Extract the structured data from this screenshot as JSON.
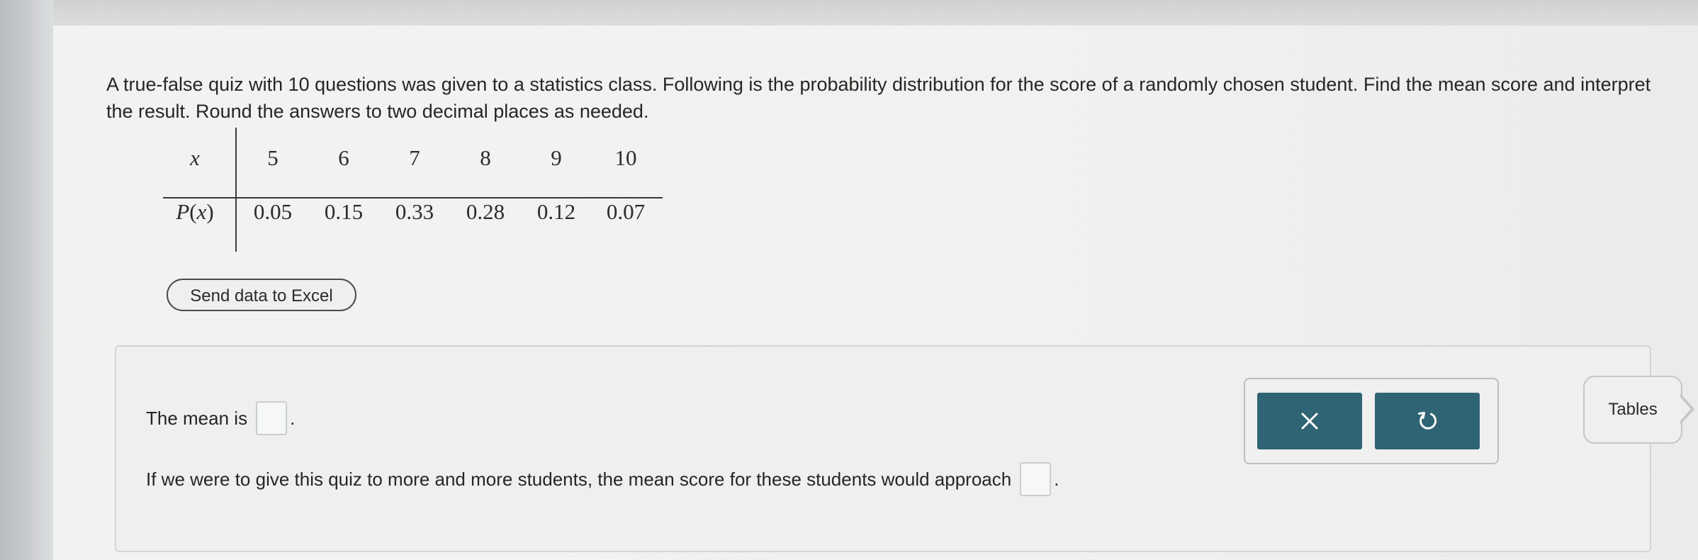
{
  "question": {
    "text": "A true-false quiz with 10 questions was given to a statistics class. Following is the probability distribution for the score of a randomly chosen student. Find the mean score and interpret the result. Round the answers to two decimal places as needed."
  },
  "table": {
    "x_label": "x",
    "p_label": "P(x)",
    "x_values": [
      "5",
      "6",
      "7",
      "8",
      "9",
      "10"
    ],
    "p_values": [
      "0.05",
      "0.15",
      "0.33",
      "0.28",
      "0.12",
      "0.07"
    ]
  },
  "excel_button": {
    "label": "Send data to Excel"
  },
  "answers": {
    "mean_prefix": "The mean is",
    "mean_value": "",
    "interpret_prefix": "If we were to give this quiz to more and more students, the mean score for these students would approach",
    "interpret_value": "",
    "period": "."
  },
  "tools": {
    "clear_icon": "close-icon",
    "undo_icon": "undo-icon",
    "button_color": "#2f6474"
  },
  "tables_tab": {
    "label": "Tables"
  }
}
